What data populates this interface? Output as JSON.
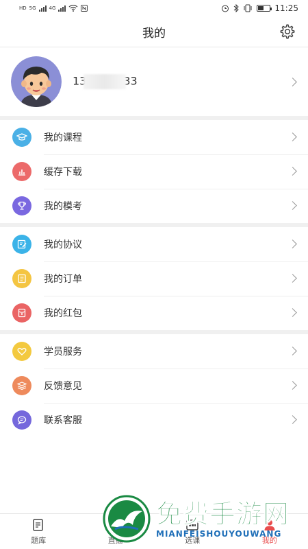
{
  "status_bar": {
    "time": "11:25",
    "network_left": "HD",
    "signal_1": "5G",
    "signal_2": "4G"
  },
  "header": {
    "title": "我的",
    "settings_icon": "gear-icon"
  },
  "profile": {
    "phone_prefix": "13",
    "phone_suffix": "33",
    "avatar_icon": "cartoon-boy-avatar"
  },
  "menu_groups": [
    [
      {
        "label": "我的课程",
        "icon": "graduation-cap-icon",
        "color": "#4ab0e6"
      },
      {
        "label": "缓存下载",
        "icon": "bar-chart-icon",
        "color": "#ec6a6a"
      },
      {
        "label": "我的模考",
        "icon": "trophy-icon",
        "color": "#7a68e0"
      }
    ],
    [
      {
        "label": "我的协议",
        "icon": "edit-document-icon",
        "color": "#3bb3e8"
      },
      {
        "label": "我的订单",
        "icon": "list-document-icon",
        "color": "#f4c542"
      },
      {
        "label": "我的红包",
        "icon": "red-packet-icon",
        "color": "#ea6464"
      }
    ],
    [
      {
        "label": "学员服务",
        "icon": "heart-icon",
        "color": "#f3c93f"
      },
      {
        "label": "反馈意见",
        "icon": "stack-icon",
        "color": "#ee8a5c"
      },
      {
        "label": "联系客服",
        "icon": "chat-bubble-icon",
        "color": "#7568dc"
      }
    ]
  ],
  "tabs": [
    {
      "label": "题库",
      "icon": "question-bank-icon",
      "active": false
    },
    {
      "label": "直播",
      "icon": "live-icon",
      "active": false
    },
    {
      "label": "选课",
      "icon": "course-select-icon",
      "active": false
    },
    {
      "label": "我的",
      "icon": "profile-icon",
      "active": true
    }
  ],
  "watermark": {
    "cn": "免费手游网",
    "en": "MIANFEISHOUYOUWANG"
  }
}
